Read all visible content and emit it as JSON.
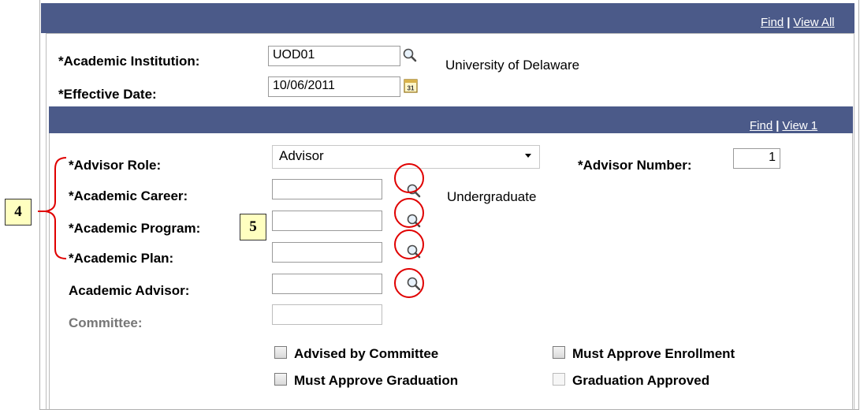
{
  "top_section": {
    "find_link": "Find",
    "separator": "|",
    "view_all_link": "View All",
    "institution_label": "*Academic Institution:",
    "institution_value": "UOD01",
    "institution_desc": "University of Delaware",
    "effective_date_label": "*Effective Date:",
    "effective_date_value": "10/06/2011"
  },
  "advisor_section": {
    "find_link": "Find",
    "separator": "|",
    "view_link": "View 1",
    "advisor_role_label": "*Advisor Role:",
    "advisor_role_value": "Advisor",
    "advisor_number_label": "*Advisor Number:",
    "advisor_number_value": "1",
    "career_label": "*Academic Career:",
    "career_value": "",
    "career_desc": "Undergraduate",
    "program_label": "*Academic Program:",
    "program_value": "",
    "plan_label": "*Academic Plan:",
    "plan_value": "",
    "advisor_label": "Academic Advisor:",
    "advisor_value": "",
    "committee_label": "Committee:",
    "committee_value": ""
  },
  "checkboxes": {
    "advised_by_committee": "Advised by Committee",
    "must_approve_enrollment": "Must Approve Enrollment",
    "must_approve_graduation": "Must Approve Graduation",
    "graduation_approved": "Graduation Approved"
  },
  "callouts": {
    "step_4": "4",
    "step_5": "5"
  },
  "colors": {
    "header": "#4b5a89",
    "annotation": "#e00000",
    "callout_bg": "#ffffc0"
  },
  "icons": [
    "lookup-icon",
    "calendar-icon"
  ]
}
